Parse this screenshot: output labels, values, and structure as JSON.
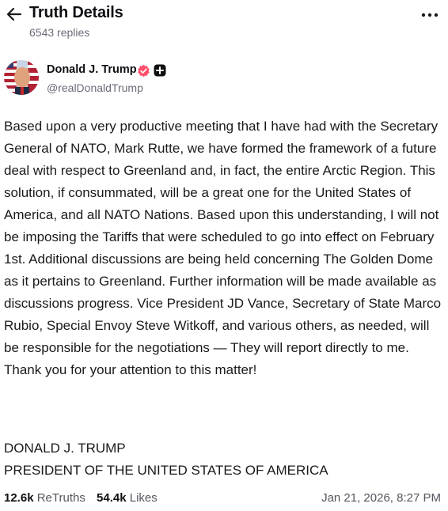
{
  "header": {
    "title": "Truth Details",
    "replies": "6543 replies",
    "back_icon": "arrow-left-icon",
    "more_icon": "more-horizontal-icon"
  },
  "author": {
    "display_name": "Donald J. Trump",
    "handle": "@realDonaldTrump",
    "verified_color": "#ff4f6a",
    "badges": [
      "verified-icon",
      "plus-badge-icon"
    ]
  },
  "post": {
    "text": "Based upon a very productive meeting that I have had with the Secretary General of NATO, Mark Rutte, we have formed the framework of a future deal with respect to Greenland and, in fact, the entire Arctic Region. This solution, if consummated, will be a great one for the United States of America, and all NATO Nations. Based upon this understanding, I will not be imposing the Tariffs that were scheduled to go into effect on February 1st. Additional discussions are being held concerning The Golden Dome as it pertains to Greenland. Further information will be made available as discussions progress. Vice President JD Vance, Secretary of State Marco Rubio, Special Envoy Steve Witkoff, and various others, as needed, will be responsible for the negotiations — They will report directly to me. Thank you for your attention to this matter!",
    "signature_line1": "DONALD J. TRUMP",
    "signature_line2": "PRESIDENT OF THE UNITED STATES OF AMERICA"
  },
  "stats": {
    "retruths_count": "12.6k",
    "retruths_label": "ReTruths",
    "likes_count": "54.4k",
    "likes_label": "Likes",
    "timestamp": "Jan 21, 2026, 8:27 PM"
  }
}
